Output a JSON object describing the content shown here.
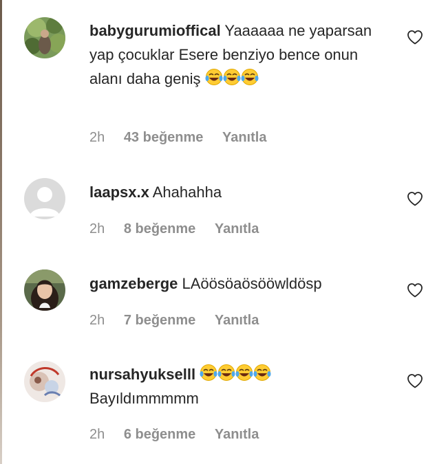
{
  "comments": [
    {
      "username": "babygurumioffical",
      "text": "Yaaaaaa ne yaparsan yap çocuklar Esere benziyo bence onun alanı daha geniş",
      "emoji_count": 3,
      "time": "2h",
      "likes": "43 beğenme",
      "reply": "Yanıtla"
    },
    {
      "username": "laapsx.x",
      "text": "Ahahahha",
      "emoji_count": 0,
      "time": "2h",
      "likes": "8 beğenme",
      "reply": "Yanıtla"
    },
    {
      "username": "gamzeberge",
      "text": "LAöösöaösööwldösp",
      "emoji_count": 0,
      "time": "2h",
      "likes": "7 beğenme",
      "reply": "Yanıtla"
    },
    {
      "username": "nursahyukselll",
      "text": "Bayıldımmmmm",
      "emoji_count": 4,
      "time": "2h",
      "likes": "6 beğenme",
      "reply": "Yanıtla"
    }
  ],
  "icons": {
    "like": "heart-outline-icon",
    "emoji": "face-with-tears-of-joy"
  },
  "colors": {
    "text": "#262626",
    "secondary": "#8e8e8e",
    "default_avatar": "#dbdbdb"
  }
}
